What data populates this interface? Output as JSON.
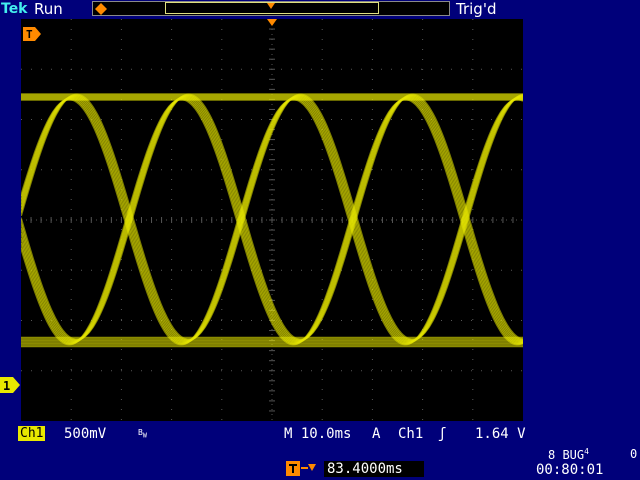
{
  "header": {
    "logo": "Tek",
    "status": "Run",
    "trigger_status": "Trig'd"
  },
  "footer": {
    "channel": "Ch1",
    "volts_div": "500mV",
    "bw_limit": "B",
    "bw_sub": "W",
    "timebase": "M 10.0ms",
    "trigger_source_label": "A",
    "trigger_channel": "Ch1",
    "trigger_slope": "ʃ",
    "trigger_level": "1.64 V",
    "delay": "83.4000ms",
    "bug_text": "8 BUG",
    "bug_sup": "4",
    "zero": "0",
    "clock": "00:80:01"
  },
  "markers": {
    "trigger_marker": "T",
    "channel1_marker": "1"
  },
  "colors": {
    "trace": "#e8e800",
    "background": "#00007a",
    "graticule": "#555555"
  }
}
